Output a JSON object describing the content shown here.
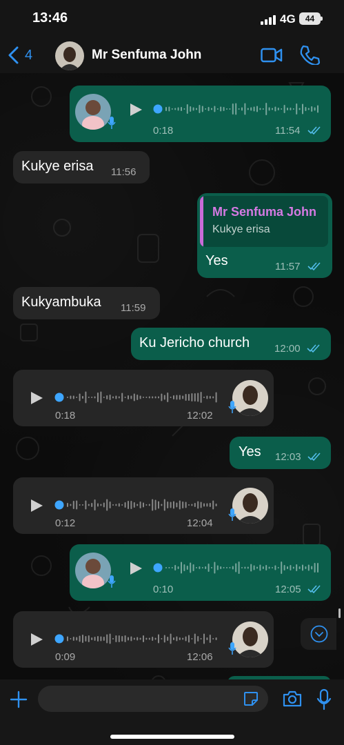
{
  "status_bar": {
    "time": "13:46",
    "network": "4G",
    "battery": "44"
  },
  "header": {
    "back_count": "4",
    "contact_name": "Mr Senfuma John",
    "icons": [
      "chevron-left-icon",
      "video-call-icon",
      "phone-icon"
    ]
  },
  "colors": {
    "accent": "#2f91f0",
    "incoming_bubble": "#262626",
    "outgoing_bubble": "#0b5e4b",
    "reply_author": "#d57ae3",
    "read_ticks": "#53bdeb"
  },
  "messages": [
    {
      "type": "voice",
      "direction": "out",
      "duration": "0:18",
      "time": "11:54",
      "status": "read"
    },
    {
      "type": "text",
      "direction": "in",
      "text": "Kukye erisa",
      "time": "11:56"
    },
    {
      "type": "reply",
      "direction": "out",
      "quoted_author": "Mr Senfuma John",
      "quoted_text": "Kukye erisa",
      "text": "Yes",
      "time": "11:57",
      "status": "read"
    },
    {
      "type": "text",
      "direction": "in",
      "text": "Kukyambuka",
      "time": "11:59"
    },
    {
      "type": "text",
      "direction": "out",
      "text": "Ku Jericho church",
      "time": "12:00",
      "status": "read"
    },
    {
      "type": "voice",
      "direction": "in",
      "duration": "0:18",
      "time": "12:02"
    },
    {
      "type": "text",
      "direction": "out",
      "text": "Yes",
      "time": "12:03",
      "status": "read"
    },
    {
      "type": "voice",
      "direction": "in",
      "duration": "0:12",
      "time": "12:04"
    },
    {
      "type": "voice",
      "direction": "out",
      "duration": "0:10",
      "time": "12:05",
      "status": "read"
    },
    {
      "type": "voice",
      "direction": "in",
      "duration": "0:09",
      "time": "12:06"
    }
  ],
  "composer": {
    "icons": [
      "plus-icon",
      "sticker-icon",
      "camera-icon",
      "microphone-icon"
    ]
  }
}
